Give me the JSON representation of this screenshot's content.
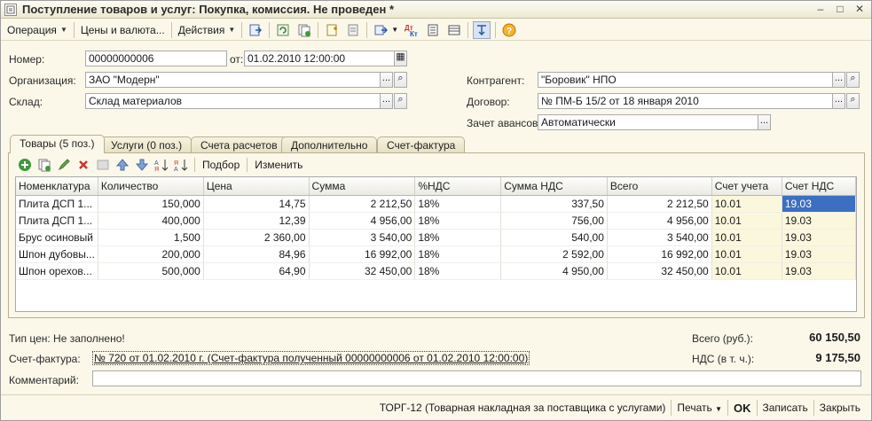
{
  "window": {
    "title": "Поступление товаров и услуг: Покупка, комиссия. Не проведен *",
    "controls": {
      "minimize": "–",
      "maximize": "□",
      "close": "✕"
    }
  },
  "toolbar": {
    "operation": "Операция",
    "prices": "Цены и валюта...",
    "actions": "Действия",
    "icons": [
      "post-icon",
      "refresh-icon",
      "copy-icon",
      "new-doc-icon",
      "docs-icon",
      "exchange-icon",
      "dt-kt-icon",
      "report-icon",
      "tree-icon",
      "list-icon",
      "help-icon"
    ],
    "dt_label": "Дт",
    "kt_label": "Кт"
  },
  "form": {
    "number_label": "Номер:",
    "number_value": "00000000006",
    "date_from_label": "от:",
    "date_value": "01.02.2010 12:00:00",
    "org_label": "Организация:",
    "org_value": "ЗАО \"Модерн\"",
    "warehouse_label": "Склад:",
    "warehouse_value": "Склад материалов",
    "counterparty_label": "Контрагент:",
    "counterparty_value": "\"Боровик\" НПО",
    "contract_label": "Договор:",
    "contract_value": "№ ПМ-Б 15/2 от 18 января 2010",
    "advance_label": "Зачет авансов:",
    "advance_value": "Автоматически"
  },
  "tabs": [
    {
      "label": "Товары (5 поз.)",
      "active": true
    },
    {
      "label": "Услуги (0 поз.)",
      "active": false
    },
    {
      "label": "Счета расчетов",
      "active": false
    },
    {
      "label": "Дополнительно",
      "active": false
    },
    {
      "label": "Счет-фактура",
      "active": false
    }
  ],
  "subtoolbar": {
    "selection": "Подбор",
    "change": "Изменить"
  },
  "table": {
    "columns": [
      "Номенклатура",
      "Количество",
      "Цена",
      "Сумма",
      "%НДС",
      "Сумма НДС",
      "Всего",
      "Счет учета",
      "Счет НДС"
    ],
    "rows": [
      [
        "Плита ДСП 1...",
        "150,000",
        "14,75",
        "2 212,50",
        "18%",
        "337,50",
        "2 212,50",
        "10.01",
        "19.03"
      ],
      [
        "Плита ДСП 1...",
        "400,000",
        "12,39",
        "4 956,00",
        "18%",
        "756,00",
        "4 956,00",
        "10.01",
        "19.03"
      ],
      [
        "Брус осиновый",
        "1,500",
        "2 360,00",
        "3 540,00",
        "18%",
        "540,00",
        "3 540,00",
        "10.01",
        "19.03"
      ],
      [
        "Шпон дубовы...",
        "200,000",
        "84,96",
        "16 992,00",
        "18%",
        "2 592,00",
        "16 992,00",
        "10.01",
        "19.03"
      ],
      [
        "Шпон орехов...",
        "500,000",
        "64,90",
        "32 450,00",
        "18%",
        "4 950,00",
        "32 450,00",
        "10.01",
        "19.03"
      ]
    ]
  },
  "bottom": {
    "price_type": "Тип цен: Не заполнено!",
    "total_label": "Всего (руб.):",
    "total_value": "60 150,50",
    "vat_label": "НДС (в т. ч.):",
    "vat_value": "9 175,50",
    "invoice_label": "Счет-фактура:",
    "invoice_value": "№ 720 от 01.02.2010 г. (Счет-фактура полученный 00000000006 от 01.02.2010 12:00:00)",
    "comment_label": "Комментарий:",
    "comment_value": ""
  },
  "footer": {
    "torg": "ТОРГ-12 (Товарная накладная за поставщика с услугами)",
    "print": "Печать",
    "ok": "OK",
    "save": "Записать",
    "close": "Закрыть"
  }
}
